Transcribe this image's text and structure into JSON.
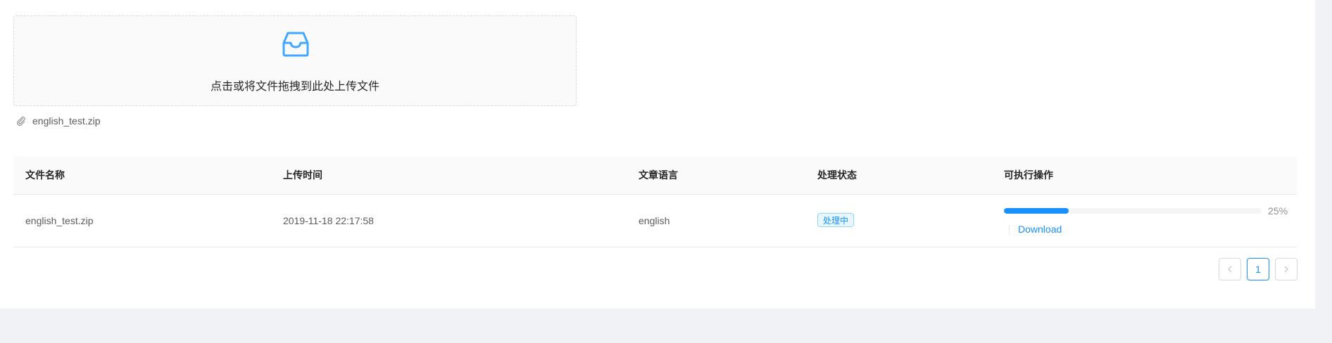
{
  "upload": {
    "hint": "点击或将文件拖拽到此处上传文件",
    "icon": "inbox-icon",
    "file_icon": "paperclip-icon",
    "file_name": "english_test.zip"
  },
  "table": {
    "columns": [
      "文件名称",
      "上传时间",
      "文章语言",
      "处理状态",
      "可执行操作"
    ],
    "rows": [
      {
        "file_name": "english_test.zip",
        "upload_time": "2019-11-18 22:17:58",
        "language": "english",
        "status": "处理中",
        "progress": 25,
        "progress_label": "25%",
        "action": "Download"
      }
    ]
  },
  "pagination": {
    "prev_icon": "chevron-left-icon",
    "current": "1",
    "next_icon": "chevron-right-icon"
  },
  "colors": {
    "primary": "#1890ff",
    "tag_bg": "#e6f7ff",
    "tag_border": "#91d5ff",
    "panel_bg": "#ffffff",
    "page_bg": "#f0f2f5"
  }
}
